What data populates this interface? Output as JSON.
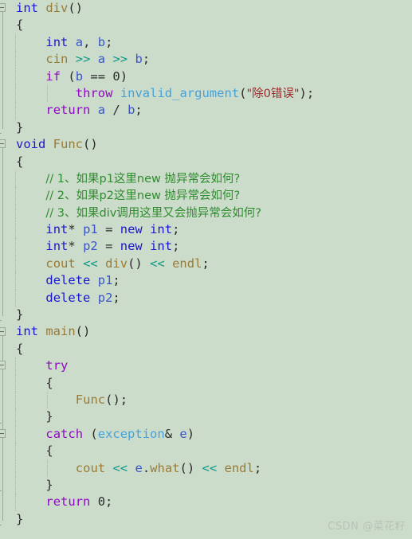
{
  "editor": {
    "language": "C++",
    "background_color": "#ccdccb",
    "watermark": "CSDN @菜花籽",
    "theme_colors": {
      "background": "#ccdccb",
      "default_text": "#2b2b2b",
      "keyword_purple": "#8f08c4",
      "keyword_blue": "#1b16d0",
      "type": "#46a2d9",
      "function": "#9a7b36",
      "variable": "#3a55c8",
      "operator": "#0f9a88",
      "string": "#9c2828",
      "comment": "#2e8b2e",
      "gutter_line": "#9aa89a",
      "indent_guide": "#a9b7a8",
      "watermark": "#b6c4b5"
    }
  },
  "fold_markers": [
    {
      "line": 0,
      "type": "collapse-box"
    },
    {
      "line": 8,
      "type": "collapse-box"
    },
    {
      "line": 19,
      "type": "collapse-box"
    },
    {
      "line": 21,
      "type": "collapse-box"
    },
    {
      "line": 25,
      "type": "collapse-box"
    }
  ],
  "code_lines": [
    {
      "n": 1,
      "indent": 0,
      "text": "int div()"
    },
    {
      "n": 2,
      "indent": 0,
      "text": "{"
    },
    {
      "n": 3,
      "indent": 1,
      "text": "int a, b;"
    },
    {
      "n": 4,
      "indent": 1,
      "text": "cin >> a >> b;"
    },
    {
      "n": 5,
      "indent": 1,
      "text": "if (b == 0)"
    },
    {
      "n": 6,
      "indent": 2,
      "text": "throw invalid_argument(\"除0错误\");"
    },
    {
      "n": 7,
      "indent": 1,
      "text": "return a / b;"
    },
    {
      "n": 8,
      "indent": 0,
      "text": "}"
    },
    {
      "n": 9,
      "indent": 0,
      "text": "void Func()"
    },
    {
      "n": 10,
      "indent": 0,
      "text": "{"
    },
    {
      "n": 11,
      "indent": 1,
      "text": "// 1、如果p1这里new 抛异常会如何?"
    },
    {
      "n": 12,
      "indent": 1,
      "text": "// 2、如果p2这里new 抛异常会如何?"
    },
    {
      "n": 13,
      "indent": 1,
      "text": "// 3、如果div调用这里又会抛异常会如何?"
    },
    {
      "n": 14,
      "indent": 1,
      "text": "int* p1 = new int;"
    },
    {
      "n": 15,
      "indent": 1,
      "text": "int* p2 = new int;"
    },
    {
      "n": 16,
      "indent": 1,
      "text": "cout << div() << endl;"
    },
    {
      "n": 17,
      "indent": 1,
      "text": "delete p1;"
    },
    {
      "n": 18,
      "indent": 1,
      "text": "delete p2;"
    },
    {
      "n": 19,
      "indent": 0,
      "text": "}"
    },
    {
      "n": 20,
      "indent": 0,
      "text": "int main()"
    },
    {
      "n": 21,
      "indent": 0,
      "text": "{"
    },
    {
      "n": 22,
      "indent": 1,
      "text": "try"
    },
    {
      "n": 23,
      "indent": 1,
      "text": "{"
    },
    {
      "n": 24,
      "indent": 2,
      "text": "Func();"
    },
    {
      "n": 25,
      "indent": 1,
      "text": "}"
    },
    {
      "n": 26,
      "indent": 1,
      "text": "catch (exception& e)"
    },
    {
      "n": 27,
      "indent": 1,
      "text": "{"
    },
    {
      "n": 28,
      "indent": 2,
      "text": "cout << e.what() << endl;"
    },
    {
      "n": 29,
      "indent": 1,
      "text": "}"
    },
    {
      "n": 30,
      "indent": 1,
      "text": "return 0;"
    },
    {
      "n": 31,
      "indent": 0,
      "text": "}"
    }
  ],
  "tokens": {
    "l1": [
      [
        "kwb",
        "int"
      ],
      [
        "pun",
        " "
      ],
      [
        "fn",
        "div"
      ],
      [
        "pun",
        "()"
      ]
    ],
    "l2": [
      [
        "pun",
        "{"
      ]
    ],
    "l3": [
      [
        "kwb",
        "int"
      ],
      [
        "pun",
        " "
      ],
      [
        "var",
        "a"
      ],
      [
        "pun",
        ", "
      ],
      [
        "var",
        "b"
      ],
      [
        "pun",
        ";"
      ]
    ],
    "l4": [
      [
        "fn",
        "cin"
      ],
      [
        "pun",
        " "
      ],
      [
        "op",
        ">>"
      ],
      [
        "pun",
        " "
      ],
      [
        "var",
        "a"
      ],
      [
        "pun",
        " "
      ],
      [
        "op",
        ">>"
      ],
      [
        "pun",
        " "
      ],
      [
        "var",
        "b"
      ],
      [
        "pun",
        ";"
      ]
    ],
    "l5": [
      [
        "kw",
        "if"
      ],
      [
        "pun",
        " ("
      ],
      [
        "var",
        "b"
      ],
      [
        "pun",
        " == 0)"
      ]
    ],
    "l6": [
      [
        "kw",
        "throw"
      ],
      [
        "pun",
        " "
      ],
      [
        "typ",
        "invalid_argument"
      ],
      [
        "pun",
        "("
      ],
      [
        "str",
        "\"除0错误\""
      ],
      [
        "pun",
        ");"
      ]
    ],
    "l7": [
      [
        "kw",
        "return"
      ],
      [
        "pun",
        " "
      ],
      [
        "var",
        "a"
      ],
      [
        "pun",
        " / "
      ],
      [
        "var",
        "b"
      ],
      [
        "pun",
        ";"
      ]
    ],
    "l8": [
      [
        "pun",
        "}"
      ]
    ],
    "l9": [
      [
        "kwb",
        "void"
      ],
      [
        "pun",
        " "
      ],
      [
        "fn",
        "Func"
      ],
      [
        "pun",
        "()"
      ]
    ],
    "l10": [
      [
        "pun",
        "{"
      ]
    ],
    "l11": [
      [
        "cmt",
        "// 1、如果p1这里new 抛异常会如何?"
      ]
    ],
    "l12": [
      [
        "cmt",
        "// 2、如果p2这里new 抛异常会如何?"
      ]
    ],
    "l13": [
      [
        "cmt",
        "// 3、如果div调用这里又会抛异常会如何?"
      ]
    ],
    "l14": [
      [
        "kwb",
        "int"
      ],
      [
        "pun",
        "* "
      ],
      [
        "var",
        "p1"
      ],
      [
        "pun",
        " = "
      ],
      [
        "kwb",
        "new"
      ],
      [
        "pun",
        " "
      ],
      [
        "kwb",
        "int"
      ],
      [
        "pun",
        ";"
      ]
    ],
    "l15": [
      [
        "kwb",
        "int"
      ],
      [
        "pun",
        "* "
      ],
      [
        "var",
        "p2"
      ],
      [
        "pun",
        " = "
      ],
      [
        "kwb",
        "new"
      ],
      [
        "pun",
        " "
      ],
      [
        "kwb",
        "int"
      ],
      [
        "pun",
        ";"
      ]
    ],
    "l16": [
      [
        "fn",
        "cout"
      ],
      [
        "pun",
        " "
      ],
      [
        "op",
        "<<"
      ],
      [
        "pun",
        " "
      ],
      [
        "fn",
        "div"
      ],
      [
        "pun",
        "() "
      ],
      [
        "op",
        "<<"
      ],
      [
        "pun",
        " "
      ],
      [
        "fn",
        "endl"
      ],
      [
        "pun",
        ";"
      ]
    ],
    "l17": [
      [
        "kwb",
        "delete"
      ],
      [
        "pun",
        " "
      ],
      [
        "var",
        "p1"
      ],
      [
        "pun",
        ";"
      ]
    ],
    "l18": [
      [
        "kwb",
        "delete"
      ],
      [
        "pun",
        " "
      ],
      [
        "var",
        "p2"
      ],
      [
        "pun",
        ";"
      ]
    ],
    "l19": [
      [
        "pun",
        "}"
      ]
    ],
    "l20": [
      [
        "kwb",
        "int"
      ],
      [
        "pun",
        " "
      ],
      [
        "fn",
        "main"
      ],
      [
        "pun",
        "()"
      ]
    ],
    "l21": [
      [
        "pun",
        "{"
      ]
    ],
    "l22": [
      [
        "kw",
        "try"
      ]
    ],
    "l23": [
      [
        "pun",
        "{"
      ]
    ],
    "l24": [
      [
        "fn",
        "Func"
      ],
      [
        "pun",
        "();"
      ]
    ],
    "l25": [
      [
        "pun",
        "}"
      ]
    ],
    "l26": [
      [
        "kw",
        "catch"
      ],
      [
        "pun",
        " ("
      ],
      [
        "typ",
        "exception"
      ],
      [
        "pun",
        "& "
      ],
      [
        "var",
        "e"
      ],
      [
        "pun",
        ")"
      ]
    ],
    "l27": [
      [
        "pun",
        "{"
      ]
    ],
    "l28": [
      [
        "fn",
        "cout"
      ],
      [
        "pun",
        " "
      ],
      [
        "op",
        "<<"
      ],
      [
        "pun",
        " "
      ],
      [
        "var",
        "e"
      ],
      [
        "pun",
        "."
      ],
      [
        "fn",
        "what"
      ],
      [
        "pun",
        "() "
      ],
      [
        "op",
        "<<"
      ],
      [
        "pun",
        " "
      ],
      [
        "fn",
        "endl"
      ],
      [
        "pun",
        ";"
      ]
    ],
    "l29": [
      [
        "pun",
        "}"
      ]
    ],
    "l30": [
      [
        "kw",
        "return"
      ],
      [
        "pun",
        " 0;"
      ]
    ],
    "l31": [
      [
        "pun",
        "}"
      ]
    ]
  }
}
